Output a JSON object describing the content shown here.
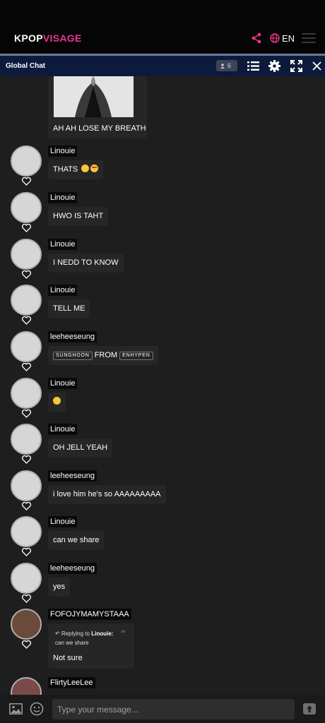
{
  "header": {
    "brand_primary": "KPOP",
    "brand_accent": "VISAGE",
    "language": "EN",
    "accent_color": "#e8358f"
  },
  "chat_header": {
    "title": "Global Chat",
    "online_count": "6"
  },
  "first_message": {
    "text": "AH AH LOSE MY BREATH"
  },
  "messages": [
    {
      "user": "Linouie",
      "text": "THATS"
    },
    {
      "user": "Linouie",
      "text": "HWO IS TAHT"
    },
    {
      "user": "Linouie",
      "text": "I NEDD TO KNOW"
    },
    {
      "user": "Linouie",
      "text": "TELL ME"
    },
    {
      "user": "leeheeseung",
      "tag1": "SUNGHOON",
      "text": "FROM",
      "tag2": "ENHYPEN"
    },
    {
      "user": "Linouie",
      "text": ""
    },
    {
      "user": "Linouie",
      "text": "OH JELL YEAH"
    },
    {
      "user": "leeheeseung",
      "text": "i love him he's so AAAAAAAAA"
    },
    {
      "user": "Linouie",
      "text": "can we share"
    },
    {
      "user": "leeheeseung",
      "text": "yes"
    }
  ],
  "reply_message": {
    "user": "FOFOJYMAMYSTAAA",
    "reply_prefix": "Replying to",
    "reply_to": "Linouie:",
    "quoted": "can we share",
    "text": "Not sure"
  },
  "last_message": {
    "user": "FlirtyLeeLee"
  },
  "composer": {
    "placeholder": "Type your message..."
  }
}
